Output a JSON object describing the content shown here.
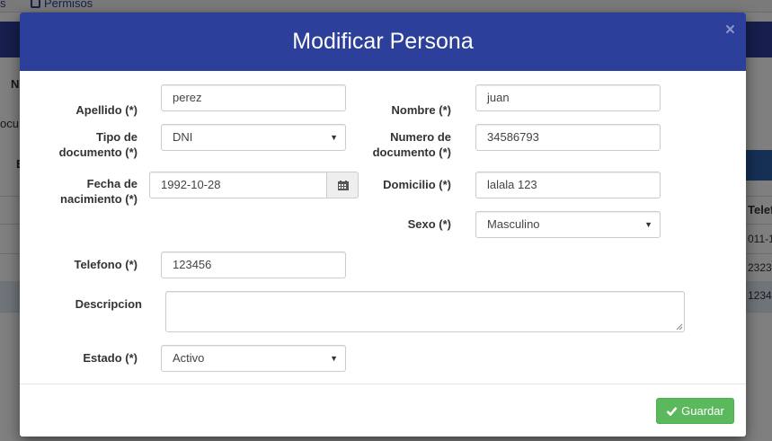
{
  "background": {
    "tab_permisos": "Permisos",
    "cut_labels": [
      "N",
      "ocu",
      "E"
    ],
    "col_header": "Telef",
    "row_values": [
      "011-1",
      "2323",
      "1234"
    ]
  },
  "modal": {
    "title": "Modificar Persona",
    "close_label": "×",
    "fields": {
      "apellido": {
        "label": "Apellido (*)",
        "value": "perez"
      },
      "nombre": {
        "label": "Nombre (*)",
        "value": "juan"
      },
      "tipo_documento": {
        "label_line1": "Tipo de",
        "label_line2": "documento (*)",
        "value": "DNI"
      },
      "numero_documento": {
        "label_line1": "Numero de",
        "label_line2": "documento (*)",
        "value": "34586793"
      },
      "fecha_nacimiento": {
        "label_line1": "Fecha de",
        "label_line2": "nacimiento (*)",
        "value": "1992-10-28"
      },
      "domicilio": {
        "label": "Domicilio (*)",
        "value": "lalala 123"
      },
      "sexo": {
        "label": "Sexo (*)",
        "value": "Masculino"
      },
      "telefono": {
        "label": "Telefono (*)",
        "value": "123456"
      },
      "descripcion": {
        "label": "Descripcion",
        "value": ""
      },
      "estado": {
        "label": "Estado (*)",
        "value": "Activo"
      }
    },
    "save_label": "Guardar"
  },
  "icons": {
    "calendar": "calendar-icon",
    "check": "check-icon",
    "close": "close-icon",
    "dropdown": "caret-down-icon",
    "permisos": "edit-icon"
  },
  "colors": {
    "header": "#2c3f9a",
    "save_button": "#5cb85c"
  }
}
